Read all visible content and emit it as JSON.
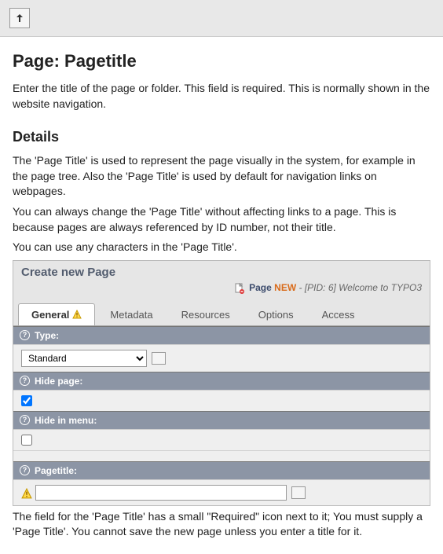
{
  "topbar": {
    "up_tooltip": "Up"
  },
  "heading": "Page: Pagetitle",
  "intro": "Enter the title of the page or folder. This field is required. This is normally shown in the website navigation.",
  "details_heading": "Details",
  "details_p1": "The 'Page Title' is used to represent the page visually in the system, for example in the page tree. Also the 'Page Title' is used by default for navigation links on webpages.",
  "details_p2": "You can always change the 'Page Title' without affecting links to a page. This is because pages are always referenced by ID number, not their title.",
  "details_p3": "You can use any characters in the 'Page Title'.",
  "panel": {
    "title": "Create new Page",
    "breadcrumb": {
      "page": "Page",
      "new": "NEW",
      "path": "- [PID: 6] Welcome to TYPO3"
    },
    "tabs": [
      {
        "label": "General",
        "active": true,
        "warn": true
      },
      {
        "label": "Metadata",
        "active": false
      },
      {
        "label": "Resources",
        "active": false
      },
      {
        "label": "Options",
        "active": false
      },
      {
        "label": "Access",
        "active": false
      }
    ],
    "fields": {
      "type": {
        "label": "Type:",
        "value": "Standard"
      },
      "hide_page": {
        "label": "Hide page:",
        "checked": true
      },
      "hide_in_menu": {
        "label": "Hide in menu:",
        "checked": false
      },
      "pagetitle": {
        "label": "Pagetitle:",
        "value": ""
      }
    }
  },
  "after_text": "The field for the 'Page Title' has a small \"Required\" icon next to it; You must supply a 'Page Title'. You cannot save the new page unless you enter a title for it."
}
